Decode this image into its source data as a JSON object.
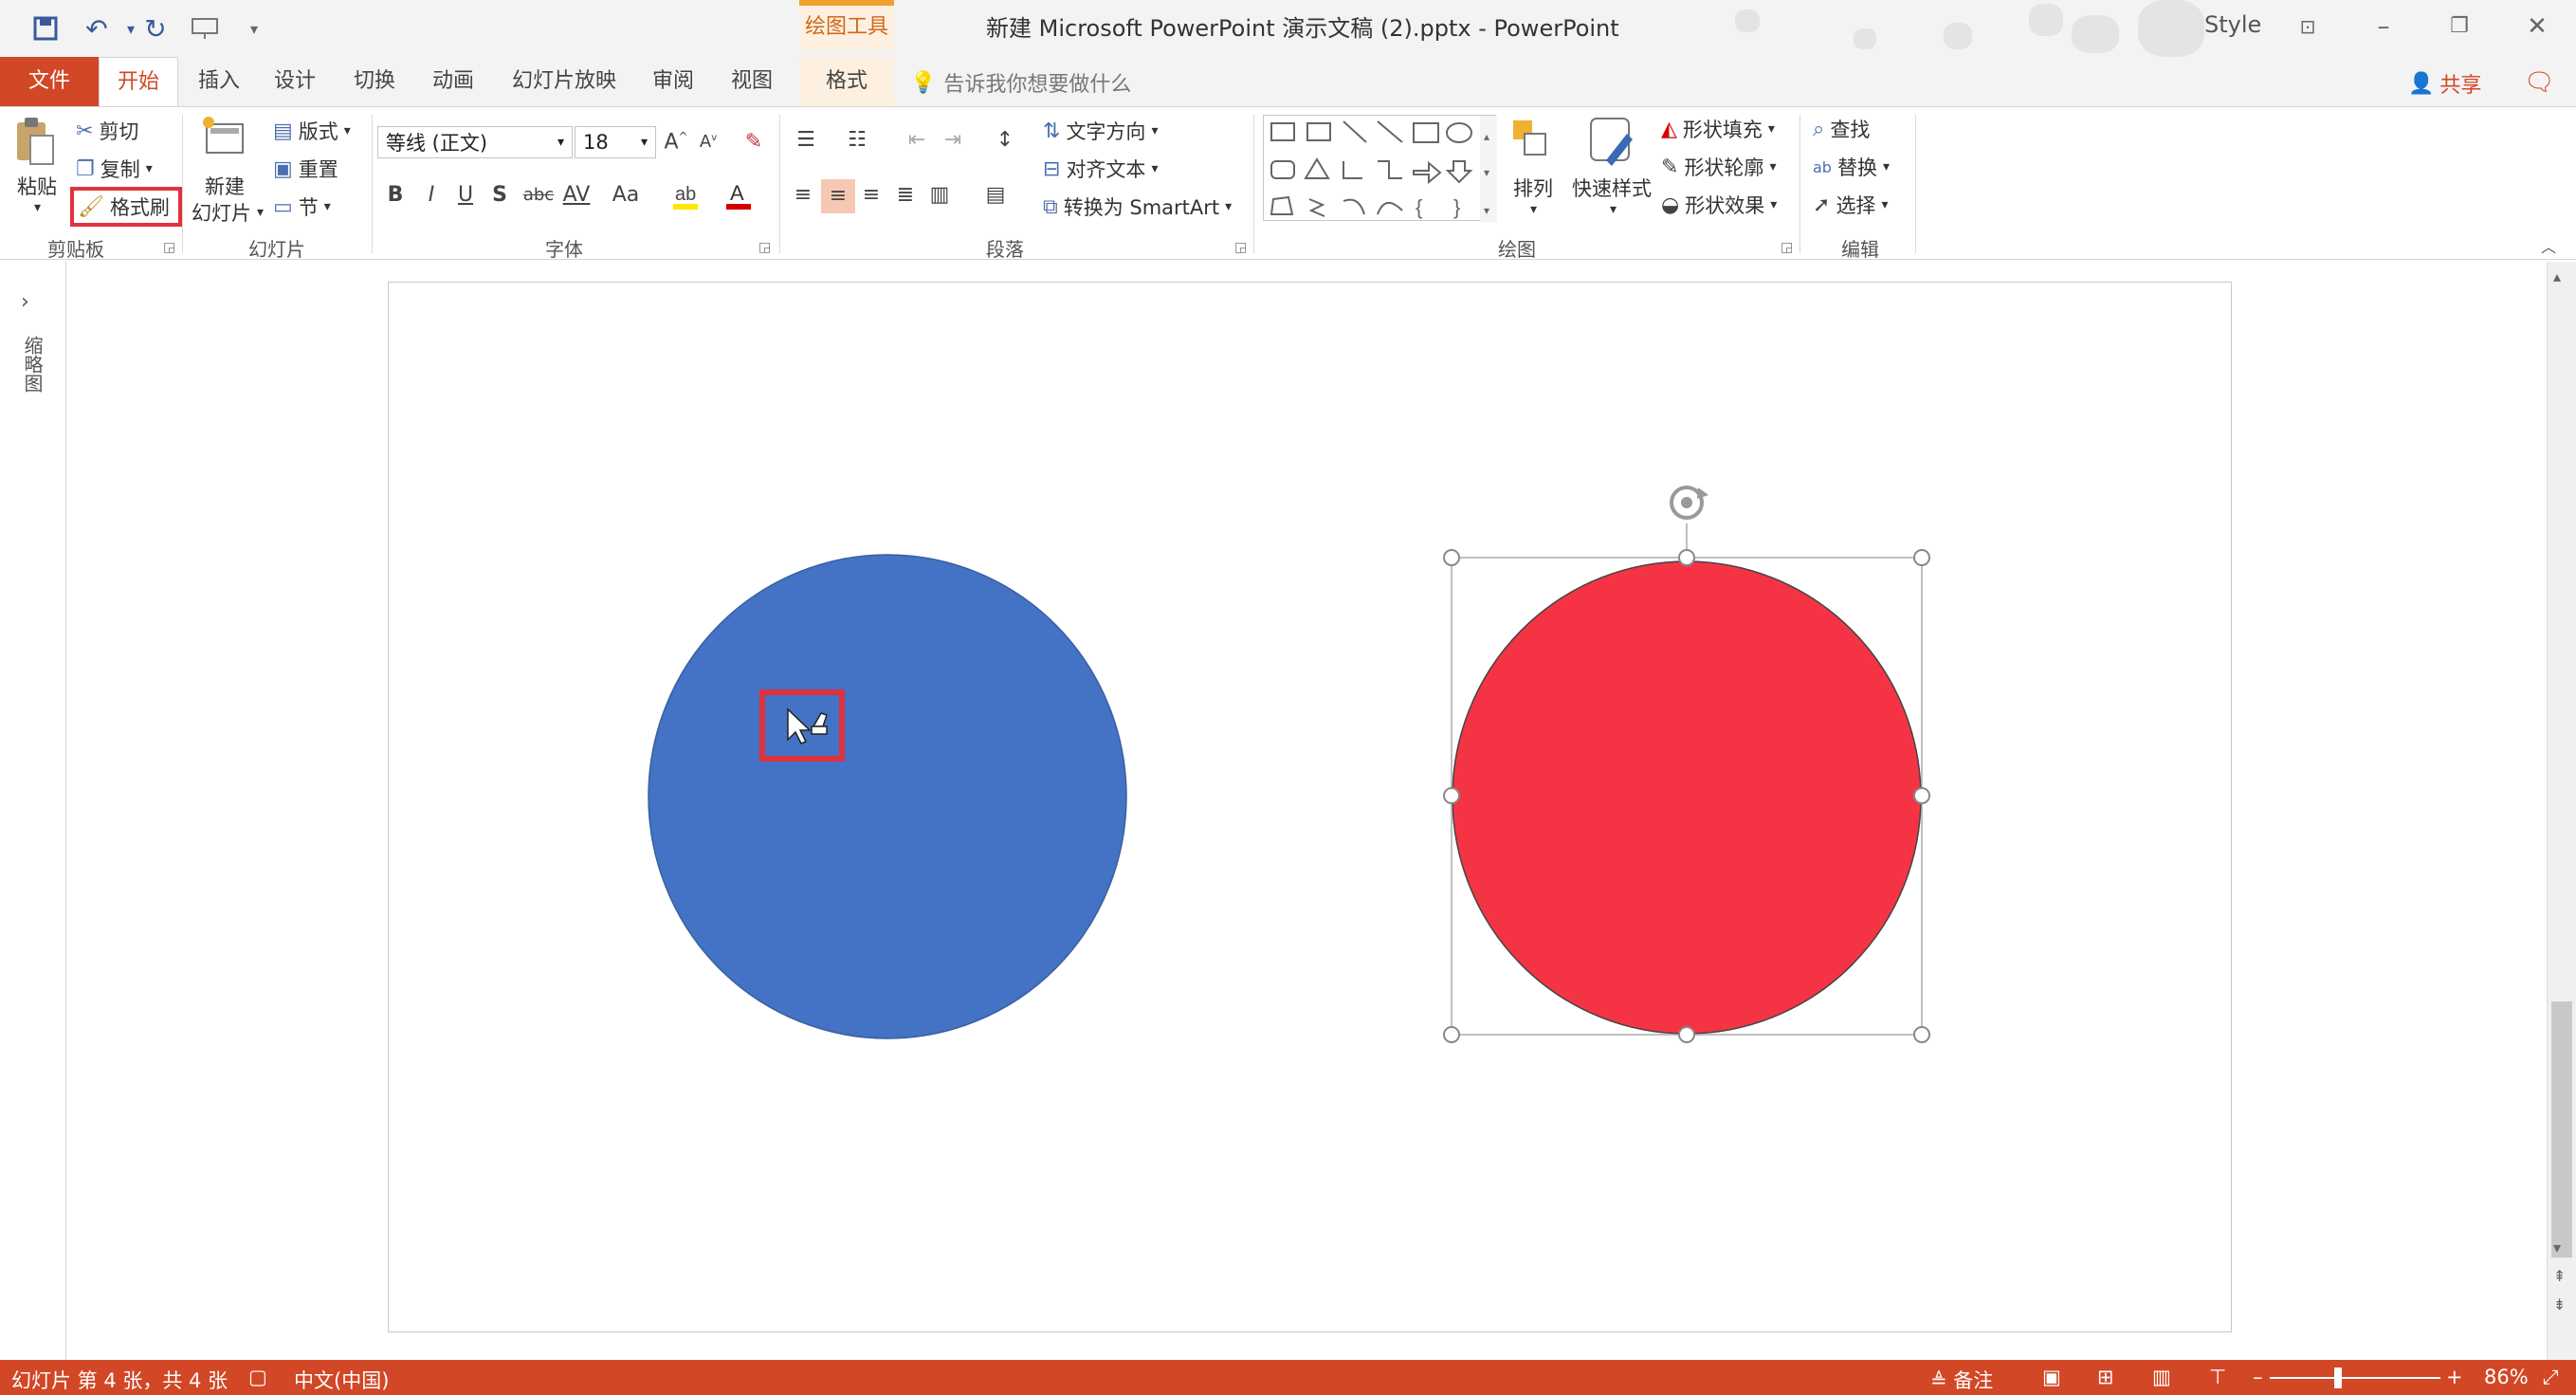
{
  "title_bar": {
    "context_tab": "绘图工具",
    "document_title": "新建 Microsoft PowerPoint 演示文稿 (2).pptx  -  PowerPoint",
    "style_label": "Style"
  },
  "tabs": {
    "file": "文件",
    "items": [
      "开始",
      "插入",
      "设计",
      "切换",
      "动画",
      "幻灯片放映",
      "审阅",
      "视图",
      "格式"
    ],
    "tell_me_placeholder": "告诉我你想要做什么",
    "share": "共享"
  },
  "ribbon": {
    "clipboard": {
      "paste": "粘贴",
      "cut": "剪切",
      "copy": "复制",
      "format_painter": "格式刷",
      "group_label": "剪贴板"
    },
    "slides": {
      "new_slide_line1": "新建",
      "new_slide_line2": "幻灯片",
      "layout": "版式",
      "reset": "重置",
      "section": "节",
      "group_label": "幻灯片"
    },
    "font": {
      "font_name": "等线 (正文)",
      "font_size": "18",
      "bold": "B",
      "italic": "I",
      "underline": "U",
      "shadow": "S",
      "strike": "abc",
      "spacing": "AV",
      "case": "Aa",
      "group_label": "字体"
    },
    "paragraph": {
      "text_direction": "文字方向",
      "align_text": "对齐文本",
      "convert_smartart": "转换为 SmartArt",
      "group_label": "段落"
    },
    "drawing": {
      "arrange": "排列",
      "quick_styles": "快速样式",
      "shape_fill": "形状填充",
      "shape_outline": "形状轮廓",
      "shape_effects": "形状效果",
      "group_label": "绘图"
    },
    "editing": {
      "find": "查找",
      "replace": "替换",
      "select": "选择",
      "group_label": "编辑"
    }
  },
  "thumbnail_pane": {
    "label": "缩略图"
  },
  "slide": {
    "left_circle_color": "#4472c4",
    "right_circle_color": "#f43444",
    "highlight_color": "#e0313e"
  },
  "status_bar": {
    "slide_info": "幻灯片 第 4 张，共 4 张",
    "language": "中文(中国)",
    "notes": "备注",
    "zoom": "86%",
    "zoom_level": 0.4
  }
}
